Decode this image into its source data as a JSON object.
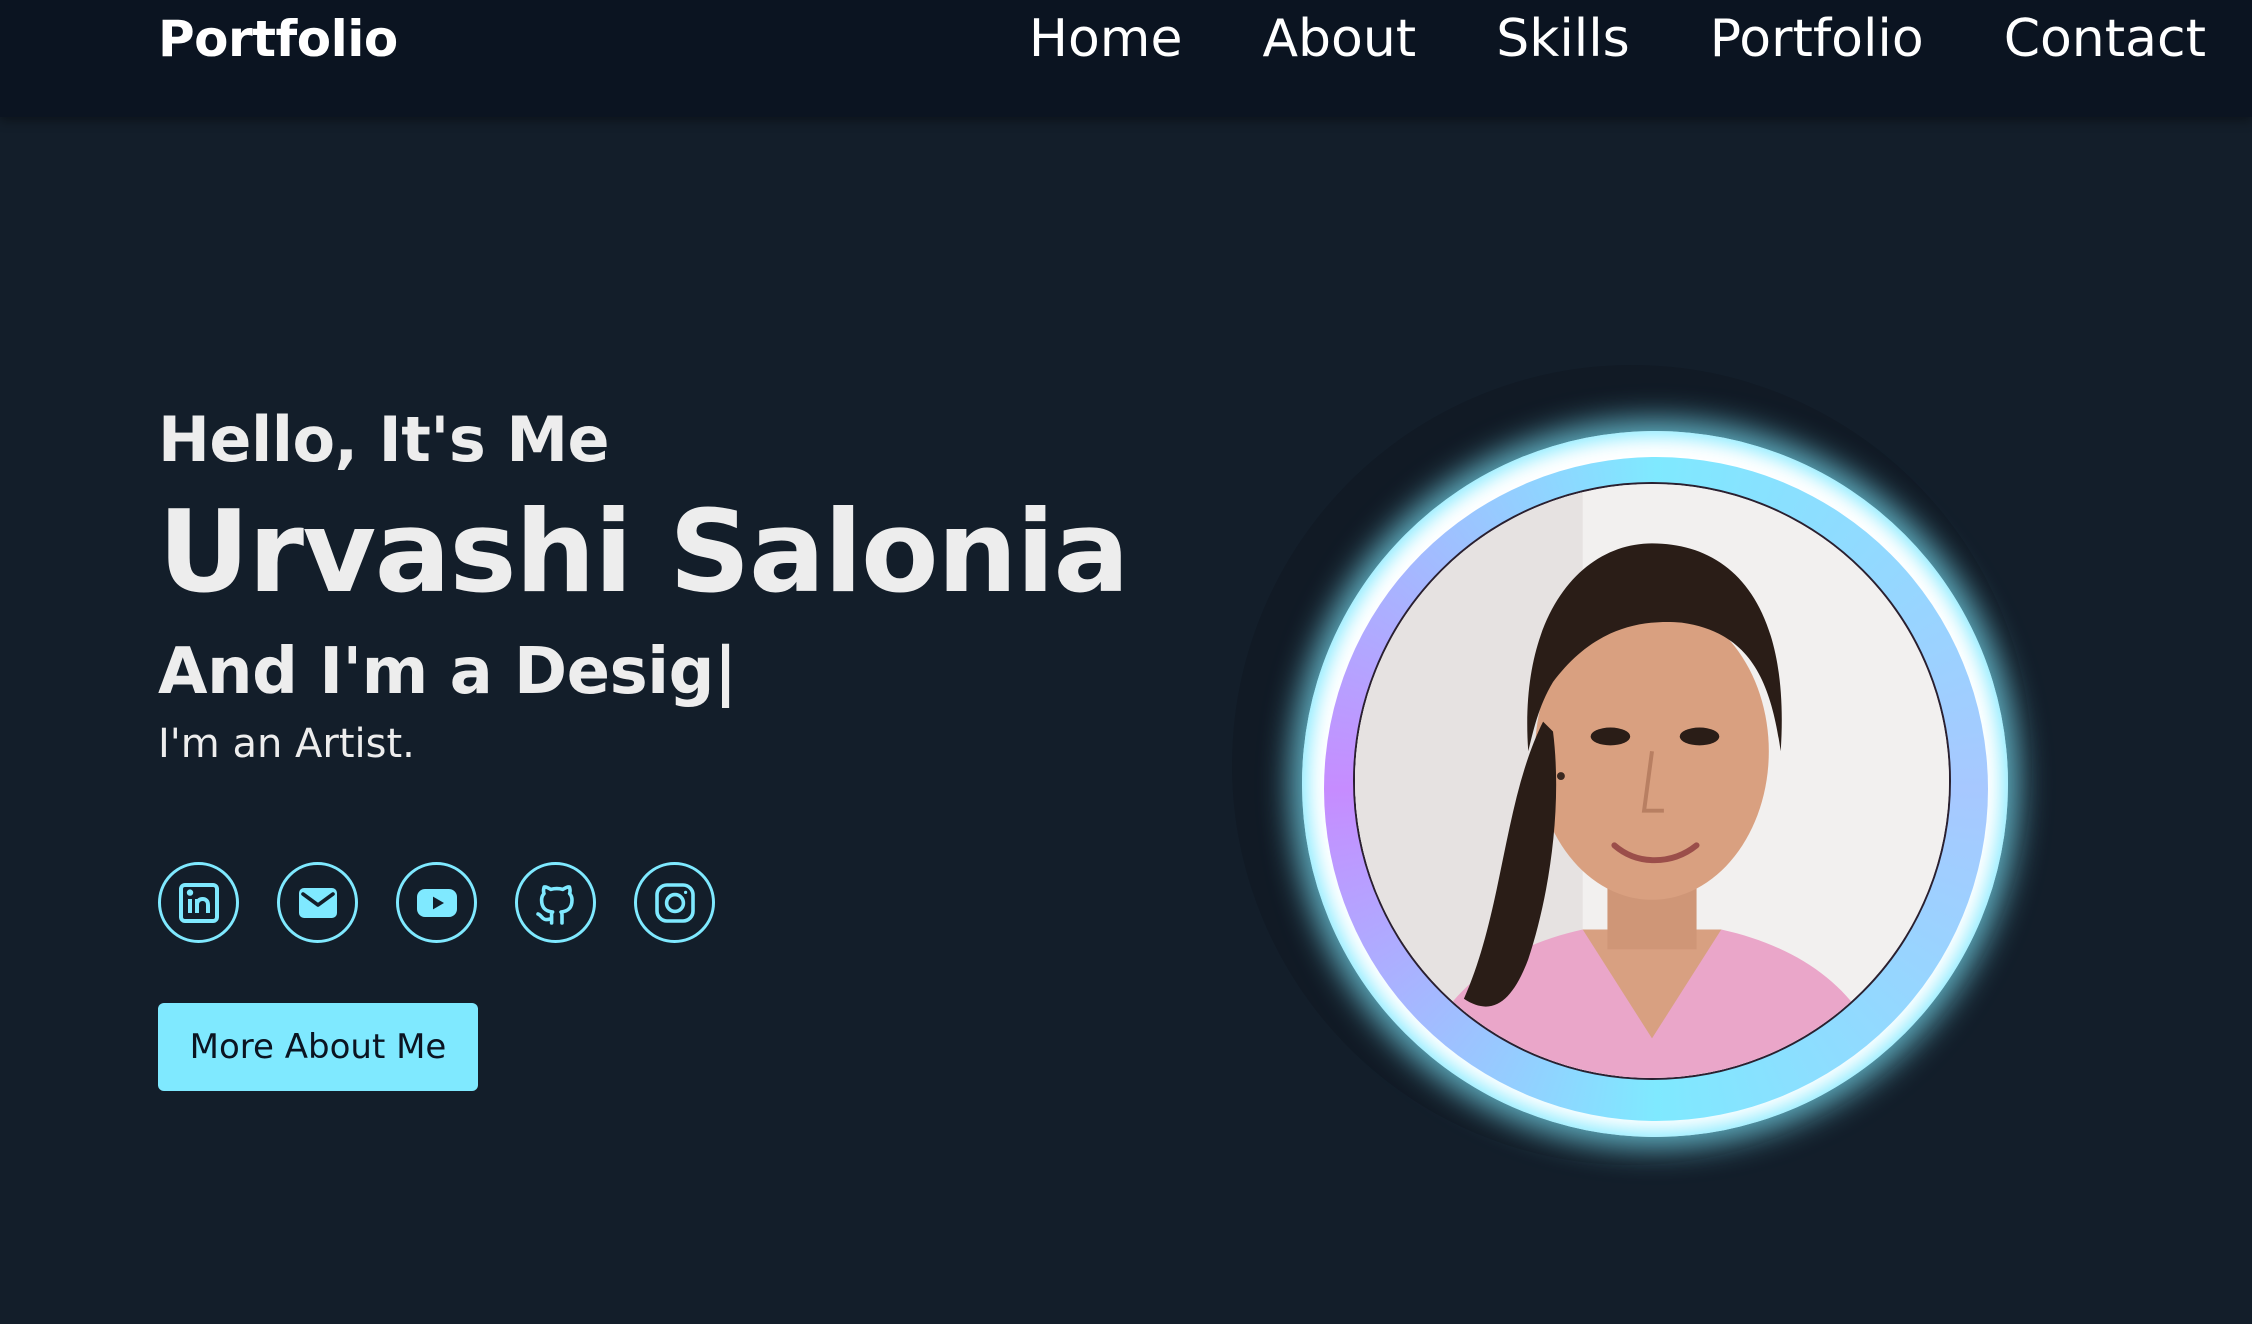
{
  "nav": {
    "logo": "Portfolio",
    "links": [
      "Home",
      "About",
      "Skills",
      "Portfolio",
      "Contact"
    ]
  },
  "hero": {
    "greeting": "Hello, It's Me",
    "name": "Urvashi Salonia",
    "role_prefix": "And I'm a Desig",
    "cursor": "|",
    "subline": "I'm an Artist.",
    "cta_label": "More About Me"
  },
  "socials": [
    {
      "icon": "linkedin-icon"
    },
    {
      "icon": "email-icon"
    },
    {
      "icon": "youtube-icon"
    },
    {
      "icon": "github-icon"
    },
    {
      "icon": "instagram-icon"
    }
  ],
  "colors": {
    "background": "#131e2a",
    "navbar": "#0b1421",
    "accent": "#7fe9ff",
    "text": "#ededed"
  }
}
